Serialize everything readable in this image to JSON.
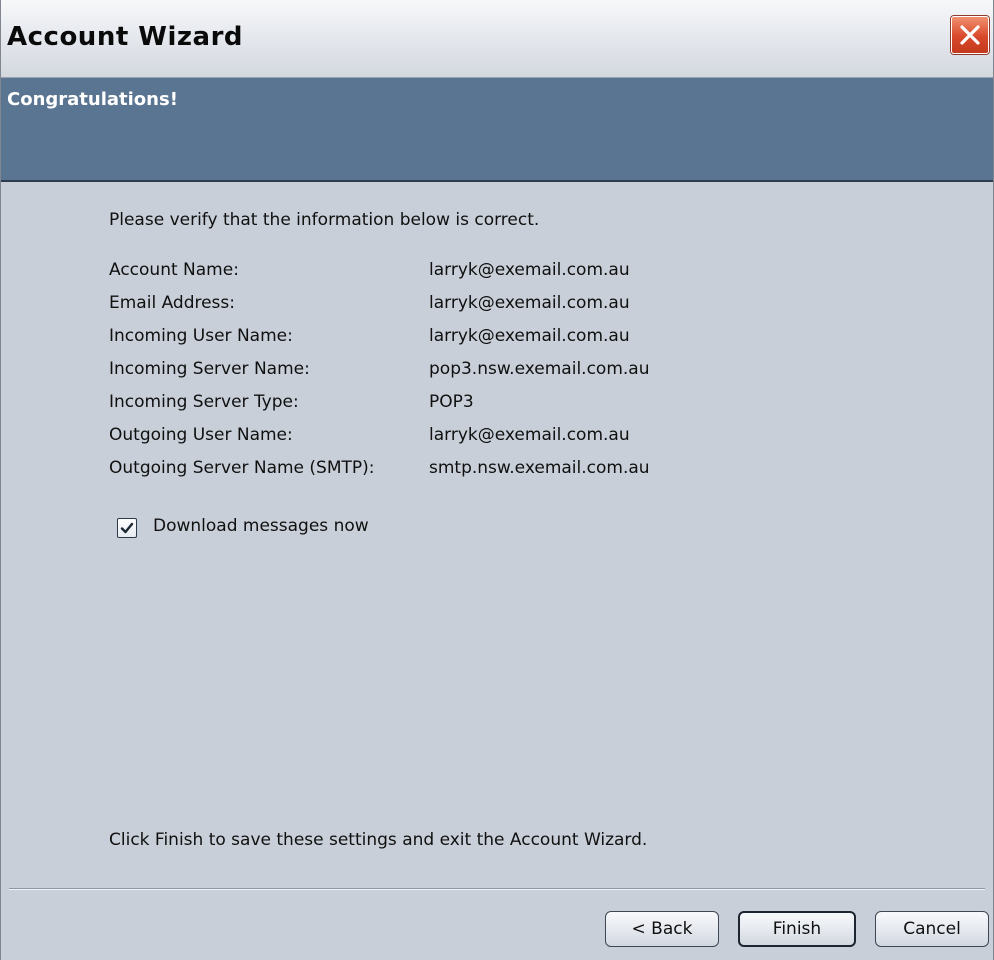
{
  "window": {
    "title": "Account Wizard"
  },
  "banner": {
    "title": "Congratulations!"
  },
  "intro": "Please verify that the information below is correct.",
  "info": [
    {
      "label": "Account Name:",
      "value": "larryk@exemail.com.au"
    },
    {
      "label": "Email Address:",
      "value": "larryk@exemail.com.au"
    },
    {
      "label": "Incoming User Name:",
      "value": "larryk@exemail.com.au"
    },
    {
      "label": "Incoming Server Name:",
      "value": "pop3.nsw.exemail.com.au"
    },
    {
      "label": "Incoming Server Type:",
      "value": "POP3"
    },
    {
      "label": "Outgoing User Name:",
      "value": "larryk@exemail.com.au"
    },
    {
      "label": "Outgoing Server Name (SMTP):",
      "value": "smtp.nsw.exemail.com.au"
    }
  ],
  "download": {
    "label": "Download messages now",
    "checked": true
  },
  "footer_text": "Click Finish to save these settings and exit the Account Wizard.",
  "buttons": {
    "back": "< Back",
    "finish": "Finish",
    "cancel": "Cancel"
  },
  "icons": {
    "close": "close-icon",
    "check": "checkmark-icon"
  },
  "colors": {
    "banner": "#5a7591",
    "content_bg": "#c8cfd8",
    "close_button": "#d9482a"
  }
}
